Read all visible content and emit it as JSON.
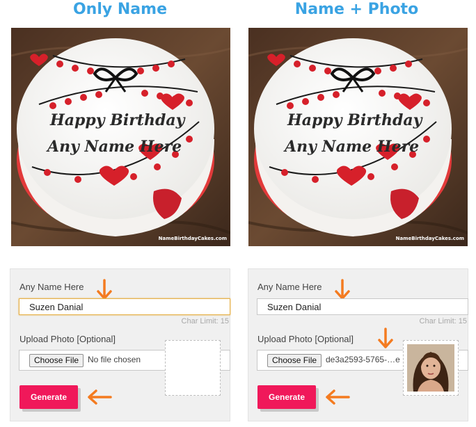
{
  "columns": [
    {
      "title": "Only Name",
      "cake": {
        "line1": "Happy Birthday",
        "line2": "Any Name Here",
        "watermark": "NameBirthdayCakes.com"
      },
      "form": {
        "name_label": "Any Name Here",
        "name_value": "Suzen Danial",
        "char_limit": "Char Limit: 15",
        "upload_label": "Upload Photo [Optional]",
        "choose_file_label": "Choose File",
        "file_status": "No file chosen",
        "generate_label": "Generate",
        "has_photo": false,
        "name_focused": true
      }
    },
    {
      "title": "Name + Photo",
      "cake": {
        "line1": "Happy Birthday",
        "line2": "Any Name Here",
        "watermark": "NameBirthdayCakes.com"
      },
      "form": {
        "name_label": "Any Name Here",
        "name_value": "Suzen Danial",
        "char_limit": "Char Limit: 15",
        "upload_label": "Upload Photo [Optional]",
        "choose_file_label": "Choose File",
        "file_status": "de3a2593-5765-…e",
        "generate_label": "Generate",
        "has_photo": true,
        "name_focused": false
      }
    }
  ],
  "colors": {
    "title": "#3aa3e3",
    "generate": "#f0185a",
    "arrow": "#f47b20",
    "focus_border": "#e6b14a"
  }
}
